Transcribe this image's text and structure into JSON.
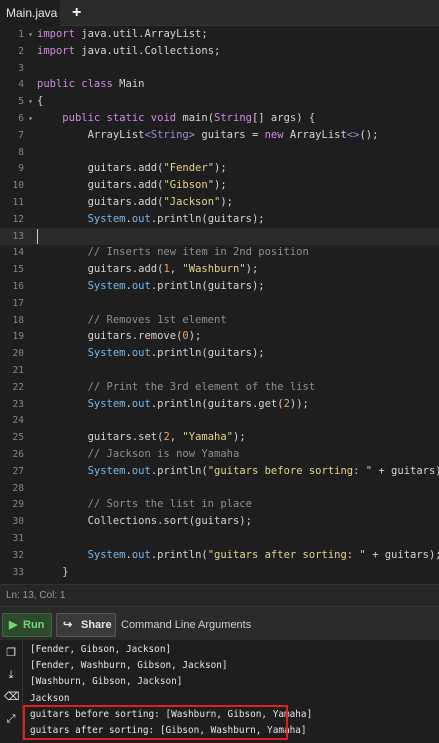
{
  "tab": {
    "title": "Main.java",
    "add": "+"
  },
  "code_lines": [
    {
      "n": "1",
      "fold": "▾",
      "segs": [
        [
          "kw",
          "import"
        ],
        [
          "p",
          " java.util.ArrayList;"
        ]
      ]
    },
    {
      "n": "2",
      "segs": [
        [
          "kw",
          "import"
        ],
        [
          "p",
          " java.util.Collections;"
        ]
      ]
    },
    {
      "n": "3",
      "segs": []
    },
    {
      "n": "4",
      "segs": [
        [
          "kw",
          "public class"
        ],
        [
          "p",
          " Main"
        ]
      ]
    },
    {
      "n": "5",
      "fold": "▾",
      "segs": [
        [
          "p",
          "{"
        ]
      ]
    },
    {
      "n": "6",
      "fold": "▾",
      "segs": [
        [
          "p",
          "    "
        ],
        [
          "kw",
          "public static void"
        ],
        [
          "p",
          " main("
        ],
        [
          "ty",
          "String"
        ],
        [
          "p",
          "[] args) {"
        ]
      ]
    },
    {
      "n": "7",
      "segs": [
        [
          "p",
          "        ArrayList"
        ],
        [
          "gen",
          "<String>"
        ],
        [
          "p",
          " guitars = "
        ],
        [
          "kw",
          "new"
        ],
        [
          "p",
          " ArrayList"
        ],
        [
          "gen",
          "<>"
        ],
        [
          "p",
          "();"
        ]
      ]
    },
    {
      "n": "8",
      "segs": []
    },
    {
      "n": "9",
      "segs": [
        [
          "p",
          "        guitars.add("
        ],
        [
          "str",
          "\"Fender\""
        ],
        [
          "p",
          ");"
        ]
      ]
    },
    {
      "n": "10",
      "segs": [
        [
          "p",
          "        guitars.add("
        ],
        [
          "str",
          "\"Gibson\""
        ],
        [
          "p",
          ");"
        ]
      ]
    },
    {
      "n": "11",
      "segs": [
        [
          "p",
          "        guitars.add("
        ],
        [
          "str",
          "\"Jackson\""
        ],
        [
          "p",
          ");"
        ]
      ]
    },
    {
      "n": "12",
      "segs": [
        [
          "p",
          "        "
        ],
        [
          "sys",
          "System"
        ],
        [
          "p",
          "."
        ],
        [
          "sys",
          "out"
        ],
        [
          "p",
          ".println(guitars);"
        ]
      ]
    },
    {
      "n": "13",
      "active": true,
      "segs": []
    },
    {
      "n": "14",
      "segs": [
        [
          "cm",
          "        // Inserts new item in 2nd position"
        ]
      ]
    },
    {
      "n": "15",
      "segs": [
        [
          "p",
          "        guitars.add("
        ],
        [
          "num",
          "1"
        ],
        [
          "p",
          ", "
        ],
        [
          "str",
          "\"Washburn\""
        ],
        [
          "p",
          ");"
        ]
      ]
    },
    {
      "n": "16",
      "segs": [
        [
          "p",
          "        "
        ],
        [
          "sys",
          "System"
        ],
        [
          "p",
          "."
        ],
        [
          "sys",
          "out"
        ],
        [
          "p",
          ".println(guitars);"
        ]
      ]
    },
    {
      "n": "17",
      "segs": []
    },
    {
      "n": "18",
      "segs": [
        [
          "cm",
          "        // Removes 1st element"
        ]
      ]
    },
    {
      "n": "19",
      "segs": [
        [
          "p",
          "        guitars.remove("
        ],
        [
          "num",
          "0"
        ],
        [
          "p",
          ");"
        ]
      ]
    },
    {
      "n": "20",
      "segs": [
        [
          "p",
          "        "
        ],
        [
          "sys",
          "System"
        ],
        [
          "p",
          "."
        ],
        [
          "sys",
          "out"
        ],
        [
          "p",
          ".println(guitars);"
        ]
      ]
    },
    {
      "n": "21",
      "segs": []
    },
    {
      "n": "22",
      "segs": [
        [
          "cm",
          "        // Print the 3rd element of the list"
        ]
      ]
    },
    {
      "n": "23",
      "segs": [
        [
          "p",
          "        "
        ],
        [
          "sys",
          "System"
        ],
        [
          "p",
          "."
        ],
        [
          "sys",
          "out"
        ],
        [
          "p",
          ".println(guitars.get("
        ],
        [
          "num",
          "2"
        ],
        [
          "p",
          "));"
        ]
      ]
    },
    {
      "n": "24",
      "segs": []
    },
    {
      "n": "25",
      "segs": [
        [
          "p",
          "        guitars.set("
        ],
        [
          "num",
          "2"
        ],
        [
          "p",
          ", "
        ],
        [
          "str",
          "\"Yamaha\""
        ],
        [
          "p",
          ");"
        ]
      ]
    },
    {
      "n": "26",
      "segs": [
        [
          "cm",
          "        // Jackson is now Yamaha"
        ]
      ]
    },
    {
      "n": "27",
      "segs": [
        [
          "p",
          "        "
        ],
        [
          "sys",
          "System"
        ],
        [
          "p",
          "."
        ],
        [
          "sys",
          "out"
        ],
        [
          "p",
          ".println("
        ],
        [
          "str",
          "\"guitars before sorting: \""
        ],
        [
          "p",
          " + guitars);"
        ]
      ]
    },
    {
      "n": "28",
      "segs": []
    },
    {
      "n": "29",
      "segs": [
        [
          "cm",
          "        // Sorts the list in place"
        ]
      ]
    },
    {
      "n": "30",
      "segs": [
        [
          "p",
          "        Collections.sort(guitars);"
        ]
      ]
    },
    {
      "n": "31",
      "segs": []
    },
    {
      "n": "32",
      "segs": [
        [
          "p",
          "        "
        ],
        [
          "sys",
          "System"
        ],
        [
          "p",
          "."
        ],
        [
          "sys",
          "out"
        ],
        [
          "p",
          ".println("
        ],
        [
          "str",
          "\"guitars after sorting: \""
        ],
        [
          "p",
          " + guitars);"
        ]
      ]
    },
    {
      "n": "33",
      "segs": [
        [
          "p",
          "    }"
        ]
      ]
    }
  ],
  "status": {
    "position": "Ln: 13,  Col: 1"
  },
  "toolbar": {
    "run_label": "Run",
    "share_label": "Share",
    "cla_label": "Command Line Arguments"
  },
  "console": {
    "lines": [
      "[Fender, Gibson, Jackson]",
      "[Fender, Washburn, Gibson, Jackson]",
      "[Washburn, Gibson, Jackson]",
      "Jackson",
      "guitars before sorting: [Washburn, Gibson, Yamaha]",
      "guitars after sorting: [Gibson, Washburn, Yamaha]"
    ]
  },
  "icons": {
    "run": "play-icon",
    "share": "share-arrow-icon",
    "side": [
      "copy-icon",
      "download-icon",
      "eraser-icon",
      "expand-icon"
    ]
  },
  "colors": {
    "highlight": "#e0201e",
    "run_green": "#74d674"
  }
}
